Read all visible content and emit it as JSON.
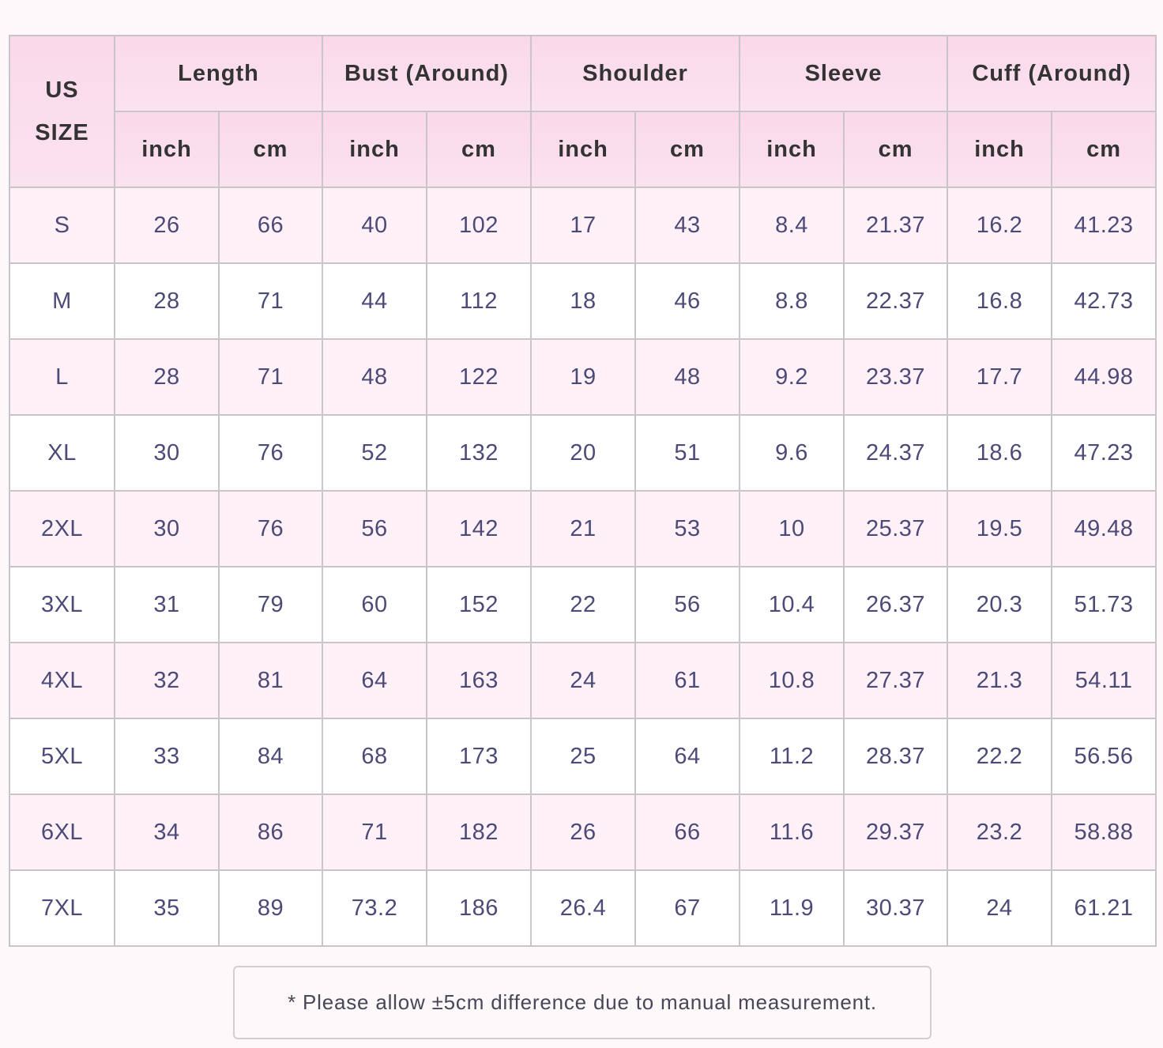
{
  "table": {
    "size_header_line1": "US",
    "size_header_line2": "SIZE",
    "groups": [
      "Length",
      "Bust (Around)",
      "Shoulder",
      "Sleeve",
      "Cuff (Around)"
    ],
    "units": [
      "inch",
      "cm",
      "inch",
      "cm",
      "inch",
      "cm",
      "inch",
      "cm",
      "inch",
      "cm"
    ],
    "rows": [
      {
        "size": "S",
        "values": [
          "26",
          "66",
          "40",
          "102",
          "17",
          "43",
          "8.4",
          "21.37",
          "16.2",
          "41.23"
        ]
      },
      {
        "size": "M",
        "values": [
          "28",
          "71",
          "44",
          "112",
          "18",
          "46",
          "8.8",
          "22.37",
          "16.8",
          "42.73"
        ]
      },
      {
        "size": "L",
        "values": [
          "28",
          "71",
          "48",
          "122",
          "19",
          "48",
          "9.2",
          "23.37",
          "17.7",
          "44.98"
        ]
      },
      {
        "size": "XL",
        "values": [
          "30",
          "76",
          "52",
          "132",
          "20",
          "51",
          "9.6",
          "24.37",
          "18.6",
          "47.23"
        ]
      },
      {
        "size": "2XL",
        "values": [
          "30",
          "76",
          "56",
          "142",
          "21",
          "53",
          "10",
          "25.37",
          "19.5",
          "49.48"
        ]
      },
      {
        "size": "3XL",
        "values": [
          "31",
          "79",
          "60",
          "152",
          "22",
          "56",
          "10.4",
          "26.37",
          "20.3",
          "51.73"
        ]
      },
      {
        "size": "4XL",
        "values": [
          "32",
          "81",
          "64",
          "163",
          "24",
          "61",
          "10.8",
          "27.37",
          "21.3",
          "54.11"
        ]
      },
      {
        "size": "5XL",
        "values": [
          "33",
          "84",
          "68",
          "173",
          "25",
          "64",
          "11.2",
          "28.37",
          "22.2",
          "56.56"
        ]
      },
      {
        "size": "6XL",
        "values": [
          "34",
          "86",
          "71",
          "182",
          "26",
          "66",
          "11.6",
          "29.37",
          "23.2",
          "58.88"
        ]
      },
      {
        "size": "7XL",
        "values": [
          "35",
          "89",
          "73.2",
          "186",
          "26.4",
          "67",
          "11.9",
          "30.37",
          "24",
          "61.21"
        ]
      }
    ]
  },
  "note": "* Please allow ±5cm difference due to manual measurement."
}
